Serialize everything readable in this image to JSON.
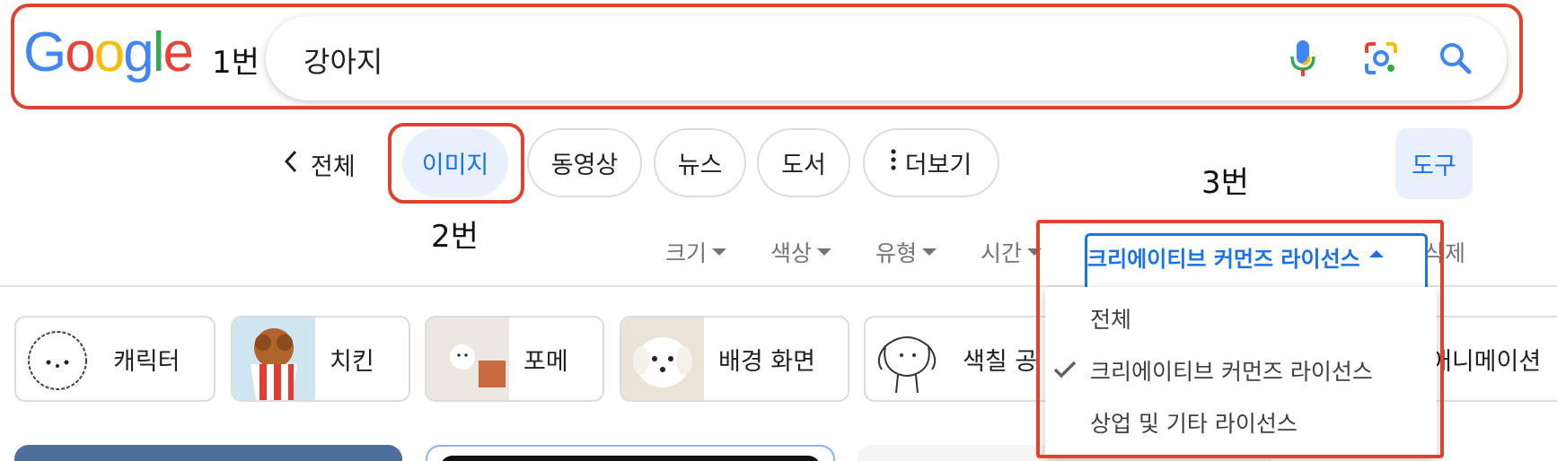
{
  "annotations": {
    "a1": "1번",
    "a2": "2번",
    "a3": "3번"
  },
  "logo": {
    "letters": [
      "G",
      "o",
      "o",
      "g",
      "l",
      "e"
    ],
    "colors": [
      "#4285F4",
      "#EA4335",
      "#FBBC05",
      "#4285F4",
      "#34A853",
      "#EA4335"
    ]
  },
  "search": {
    "query": "강아지",
    "icons": [
      "microphone-icon",
      "google-lens-icon",
      "search-icon"
    ]
  },
  "tabs": {
    "back": "전체",
    "items": [
      "이미지",
      "동영상",
      "뉴스",
      "도서",
      "더보기"
    ],
    "active": "이미지",
    "tools": "도구"
  },
  "filters": {
    "items": [
      "크기",
      "색상",
      "유형",
      "시간"
    ],
    "license": "크리에이티브 커먼즈 라이선스",
    "clear_partial": "삭제"
  },
  "license_menu": {
    "options": [
      "전체",
      "크리에이티브 커먼즈 라이선스",
      "상업 및 기타 라이선스"
    ],
    "selected": "크리에이티브 커먼즈 라이선스"
  },
  "related": [
    "캐릭터",
    "치킨",
    "포메",
    "배경 화면",
    "색칠 공",
    "애니메이션"
  ],
  "colors": {
    "accent": "#1a73e8",
    "annotation": "#e0432d",
    "chip_active_bg": "#e8f0fe"
  }
}
